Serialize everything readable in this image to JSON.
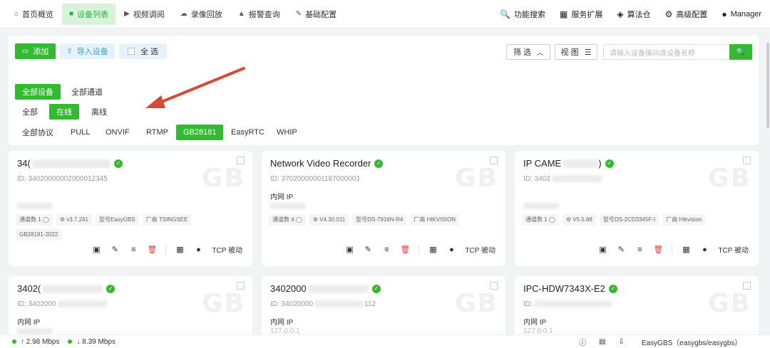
{
  "nav": {
    "items": [
      {
        "label": "首页概览",
        "icon": "home-icon",
        "glyph": "⌂"
      },
      {
        "label": "设备列表",
        "icon": "video-icon",
        "glyph": "■"
      },
      {
        "label": "视频调阅",
        "icon": "play-circle-icon",
        "glyph": "▶"
      },
      {
        "label": "录像回放",
        "icon": "cloud-icon",
        "glyph": "☁"
      },
      {
        "label": "报警查询",
        "icon": "alarm-icon",
        "glyph": "▲"
      },
      {
        "label": "基础配置",
        "icon": "wrench-icon",
        "glyph": "✎"
      }
    ],
    "active_index": 1,
    "right": [
      {
        "label": "功能搜索",
        "icon": "search-icon",
        "glyph": "🔍"
      },
      {
        "label": "服务扩展",
        "icon": "grid-icon",
        "glyph": "▦"
      },
      {
        "label": "算法仓",
        "icon": "dropbox-icon",
        "glyph": "◈"
      },
      {
        "label": "高级配置",
        "icon": "gear-icon",
        "glyph": "⚙"
      },
      {
        "label": "Manager",
        "icon": "user-icon",
        "glyph": "●"
      }
    ]
  },
  "toolbar": {
    "add_label": "添加",
    "import_label": "导入设备",
    "select_all_label": "全 选",
    "filter_label": "筛 选",
    "view_label": "视 图",
    "search_placeholder": "请输入设备编码或设备名称"
  },
  "filters": {
    "scope": [
      "全部设备",
      "全部通道"
    ],
    "scope_selected": 0,
    "status": [
      "全部",
      "在线",
      "离线"
    ],
    "status_selected": 1,
    "protocol": [
      "全部协议",
      "PULL",
      "ONVIF",
      "RTMP",
      "GB28181",
      "EasyRTC",
      "WHIP"
    ],
    "protocol_selected": 4
  },
  "cards_row1": [
    {
      "title_prefix": "34(",
      "id": "ID: 34020000002000012345",
      "lan": "",
      "tags": [
        "通道数 1 ◯",
        "⚙ v3.7.241",
        "型号EasyGBS",
        "厂商 TSINGSEE",
        "GB28181-2022"
      ]
    },
    {
      "title_prefix": "Network Video Recorder",
      "id": "ID: 37020000001187000001",
      "lan": "内网 IP",
      "tags": [
        "通道数 4 ◯",
        "⚙ V4.30.011",
        "型号DS-7916N-R4",
        "厂商 HIKVISION"
      ]
    },
    {
      "title_prefix": "IP CAME",
      "title_suffix": ")",
      "id": "ID: 3402",
      "lan": "",
      "tags": [
        "通道数 1 ◯",
        "⚙ V5.5.88",
        "型号DS-2CD3345F-I",
        "厂商 Hikvision"
      ]
    }
  ],
  "cards_row2": [
    {
      "title_prefix": "3402(",
      "id": "ID: 3402000",
      "lan": "内网 IP",
      "lan_value": ""
    },
    {
      "title_prefix": "3402000",
      "id": "ID: 34020000",
      "id_suffix": "112",
      "lan": "内网 IP",
      "lan_value": "127.0.0.1"
    },
    {
      "title_prefix": "IPC-HDW7343X-E2",
      "id": "ID:",
      "lan": "内网 IP",
      "lan_value": "127.0.0.1"
    }
  ],
  "card_common": {
    "watermark": "GB",
    "transport": "TCP 被动"
  },
  "footer": {
    "upload": "↑ 2.98 Mbps",
    "download": "↓ 8.39 Mbps",
    "app": "EasyGBS（easygbs/easygbs）"
  },
  "colors": {
    "accent": "#33bb30",
    "danger": "#e04040",
    "arrow": "#d94a32"
  }
}
